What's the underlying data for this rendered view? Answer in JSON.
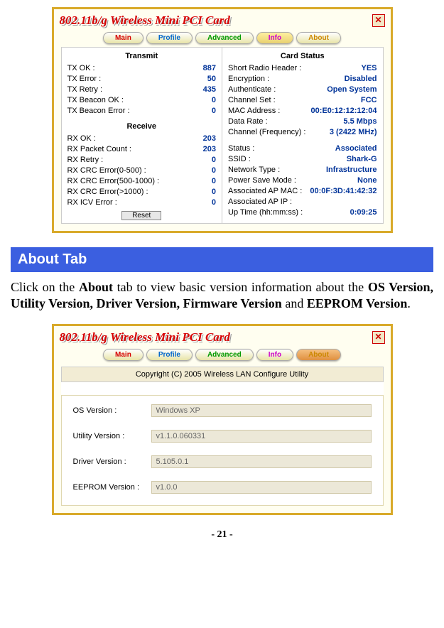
{
  "card_title": "802.11b/g Wireless Mini PCI Card",
  "close_glyph": "✕",
  "tabs": {
    "main": "Main",
    "profile": "Profile",
    "advanced": "Advanced",
    "info": "Info",
    "about": "About"
  },
  "info_panel": {
    "transmit_header": "Transmit",
    "receive_header": "Receive",
    "card_status_header": "Card Status",
    "transmit": [
      {
        "label": "TX OK :",
        "value": "887"
      },
      {
        "label": "TX Error :",
        "value": "50"
      },
      {
        "label": "TX Retry :",
        "value": "435"
      },
      {
        "label": "TX Beacon OK :",
        "value": "0"
      },
      {
        "label": "TX Beacon Error :",
        "value": "0"
      }
    ],
    "receive": [
      {
        "label": "RX OK :",
        "value": "203"
      },
      {
        "label": "RX Packet Count :",
        "value": "203"
      },
      {
        "label": "RX Retry :",
        "value": "0"
      },
      {
        "label": "RX CRC Error(0-500) :",
        "value": "0"
      },
      {
        "label": "RX CRC Error(500-1000) :",
        "value": "0"
      },
      {
        "label": "RX CRC Error(>1000) :",
        "value": "0"
      },
      {
        "label": "RX ICV Error :",
        "value": "0"
      }
    ],
    "reset_label": "Reset",
    "card_status": [
      {
        "label": "Short Radio Header :",
        "value": "YES"
      },
      {
        "label": "Encryption :",
        "value": "Disabled"
      },
      {
        "label": "Authenticate :",
        "value": "Open System"
      },
      {
        "label": "Channel Set :",
        "value": "FCC"
      },
      {
        "label": "MAC Address :",
        "value": "00:E0:12:12:12:04"
      },
      {
        "label": "Data Rate :",
        "value": "5.5 Mbps"
      },
      {
        "label": "Channel (Frequency) :",
        "value": "3 (2422 MHz)"
      }
    ],
    "card_status2": [
      {
        "label": "Status :",
        "value": "Associated"
      },
      {
        "label": "SSID :",
        "value": "Shark-G"
      },
      {
        "label": "Network Type :",
        "value": "Infrastructure"
      },
      {
        "label": "Power Save Mode :",
        "value": "None"
      },
      {
        "label": "Associated AP MAC :",
        "value": "00:0F:3D:41:42:32"
      },
      {
        "label": "Associated AP IP :",
        "value": ""
      },
      {
        "label": "Up Time (hh:mm:ss) :",
        "value": "0:09:25"
      }
    ]
  },
  "section_heading": "About Tab",
  "body_text_pre": "Click on the ",
  "body_text_bold1": "About",
  "body_text_mid": " tab to view basic version information about the ",
  "body_text_bold2": "OS Version, Utility Version, Driver Version, Firmware Version",
  "body_text_mid2": " and ",
  "body_text_bold3": "EEPROM Version",
  "body_text_end": ".",
  "about_panel": {
    "copyright": "Copyright (C) 2005  Wireless LAN Configure Utility",
    "rows": [
      {
        "label": "OS Version :",
        "value": "Windows XP"
      },
      {
        "label": "Utility Version :",
        "value": "v1.1.0.060331"
      },
      {
        "label": "Driver Version :",
        "value": "5.105.0.1"
      },
      {
        "label": "EEPROM Version :",
        "value": "v1.0.0"
      }
    ]
  },
  "page_number": "- 21 -"
}
